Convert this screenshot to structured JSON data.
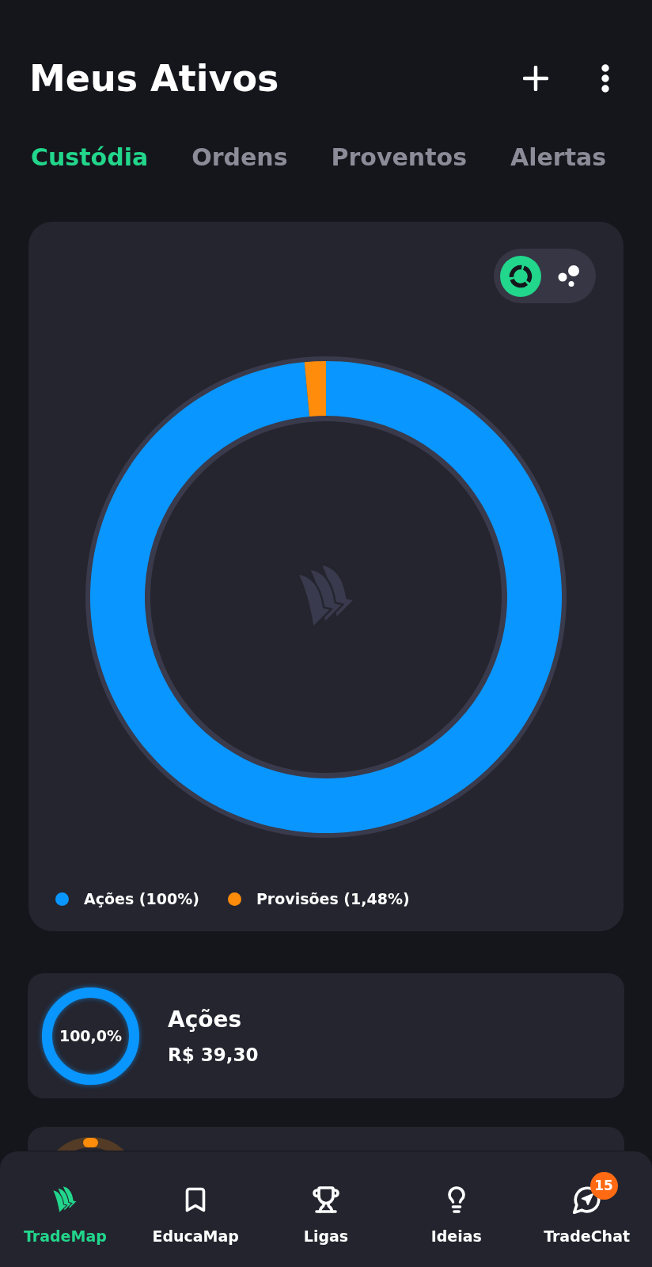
{
  "header": {
    "title": "Meus Ativos",
    "actions": [
      {
        "kind": "add"
      },
      {
        "kind": "more"
      }
    ]
  },
  "tabs": [
    {
      "label": "Custódia",
      "selected": true
    },
    {
      "label": "Ordens",
      "selected": false
    },
    {
      "label": "Proventos",
      "selected": false
    },
    {
      "label": "Alertas",
      "selected": false
    }
  ],
  "allocation_card": {
    "view_toggle": [
      {
        "kind": "donut",
        "selected": true
      },
      {
        "kind": "bubbles",
        "selected": false
      }
    ],
    "chart_data": {
      "type": "donut",
      "categories": [
        "Ações (100%)",
        "Provisões (1,48%)"
      ],
      "values": [
        100,
        1.48
      ]
    },
    "legend": [
      {
        "color": "#0a96ff"
      },
      {
        "color": "#ff8c0a"
      }
    ]
  },
  "asset_cards": [
    {
      "name": "Ações",
      "amount": "R$ 39,30",
      "percent": "100,0%",
      "level": 1,
      "color": "#0a96ff"
    },
    {
      "color": "#ff8c0a"
    }
  ],
  "bottom_nav": [
    {
      "label": "TradeMap",
      "kind": "sails",
      "selected": true
    },
    {
      "label": "EducaMap",
      "kind": "bookmark",
      "selected": false
    },
    {
      "label": "Ligas",
      "kind": "trophy",
      "selected": false
    },
    {
      "label": "Ideias",
      "kind": "lightbulb",
      "selected": false
    },
    {
      "label": "TradeChat",
      "kind": "chat",
      "selected": false,
      "badge": "15"
    }
  ]
}
